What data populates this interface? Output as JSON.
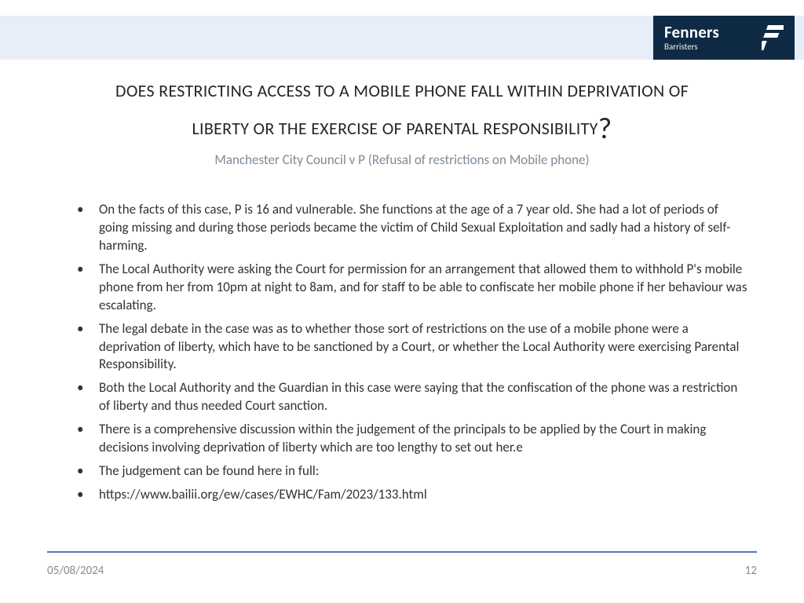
{
  "brand": {
    "name": "Fenners",
    "sub": "Barristers"
  },
  "title_line1": "DOES RESTRICTING ACCESS TO A MOBILE PHONE FALL WITHIN DEPRIVATION OF",
  "title_line2": "LIBERTY OR THE EXERCISE OF PARENTAL RESPONSIBILITY",
  "title_qmark": "?",
  "subtitle": "Manchester City Council v P (Refusal of restrictions on Mobile phone)",
  "bullets": [
    "On the facts of this case, P is 16 and vulnerable. She functions at the age of a 7 year old. She had a lot of periods of going missing and during those periods became the victim of Child Sexual Exploitation and sadly had a history of self-harming.",
    "The Local Authority were asking the Court for permission for an arrangement that allowed them to withhold P's mobile phone from her from 10pm at night to 8am, and for staff to be able to confiscate her mobile phone if her behaviour was escalating.",
    "The legal debate in the case was as to whether those sort of restrictions on the use of a mobile phone were a deprivation of liberty, which have to be sanctioned by a Court, or whether the Local Authority were exercising Parental Responsibility.",
    "Both the Local Authority and the Guardian in this case were saying that the confiscation of the phone was a restriction of liberty and thus needed Court sanction.",
    "There is a comprehensive discussion  within the judgement of the principals to be applied by the Court in making decisions involving deprivation of liberty which are too lengthy to set out her.e",
    "The judgement can be found here in full:",
    "https://www.bailii.org/ew/cases/EWHC/Fam/2023/133.html"
  ],
  "footer": {
    "date": "05/08/2024",
    "page": "12"
  }
}
